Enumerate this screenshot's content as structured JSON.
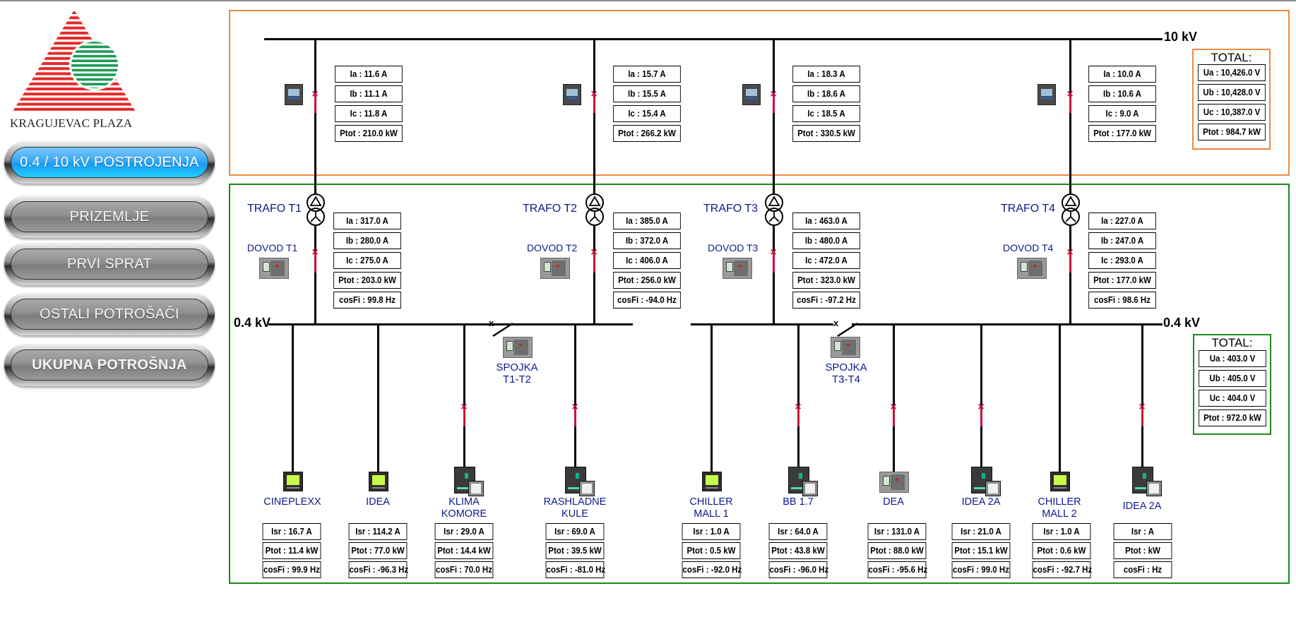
{
  "logo": {
    "text": "KRAGUJEVAC PLAZA"
  },
  "nav": [
    {
      "label": "0.4 / 10 kV POSTROJENJA",
      "active": true
    },
    {
      "label": "PRIZEMLJE",
      "active": false
    },
    {
      "label": "PRVI SPRAT",
      "active": false
    },
    {
      "label": "OSTALI POTROŠAČI",
      "active": false
    },
    {
      "label": "UKUPNA POTROŠNJA",
      "active": false
    }
  ],
  "mv": {
    "bus_label": "10 kV",
    "feeders": [
      {
        "ia": "Ia : 11.6 A",
        "ib": "Ib : 11.1 A",
        "ic": "Ic : 11.8 A",
        "ptot": "Ptot : 210.0 kW"
      },
      {
        "ia": "Ia : 15.7 A",
        "ib": "Ib : 15.5 A",
        "ic": "Ic : 15.4 A",
        "ptot": "Ptot : 266.2 kW"
      },
      {
        "ia": "Ia : 18.3 A",
        "ib": "Ib : 18.6 A",
        "ic": "Ic : 18.5 A",
        "ptot": "Ptot : 330.5 kW"
      },
      {
        "ia": "Ia : 10.0 A",
        "ib": "Ib : 10.6 A",
        "ic": "Ic : 9.0 A",
        "ptot": "Ptot : 177.0 kW"
      }
    ],
    "total": {
      "title": "TOTAL:",
      "ua": "Ua : 10,426.0 V",
      "ub": "Ub : 10,428.0 V",
      "uc": "Uc : 10,387.0 V",
      "ptot": "Ptot : 984.7 kW"
    }
  },
  "lv": {
    "bus_label": "0.4 kV",
    "transformers": [
      {
        "trafo": "TRAFO T1",
        "dovod": "DOVOD T1",
        "ia": "Ia : 317.0 A",
        "ib": "Ib : 280.0 A",
        "ic": "Ic : 275.0 A",
        "ptot": "Ptot : 203.0 kW",
        "cosfi": "cosFi : 99.8 Hz"
      },
      {
        "trafo": "TRAFO T2",
        "dovod": "DOVOD T2",
        "ia": "Ia : 385.0 A",
        "ib": "Ib : 372.0 A",
        "ic": "Ic : 406.0 A",
        "ptot": "Ptot : 256.0 kW",
        "cosfi": "cosFi : -94.0 Hz"
      },
      {
        "trafo": "TRAFO T3",
        "dovod": "DOVOD T3",
        "ia": "Ia : 463.0 A",
        "ib": "Ib : 480.0 A",
        "ic": "Ic : 472.0 A",
        "ptot": "Ptot : 323.0 kW",
        "cosfi": "cosFi : -97.2 Hz"
      },
      {
        "trafo": "TRAFO T4",
        "dovod": "DOVOD T4",
        "ia": "Ia : 227.0 A",
        "ib": "Ib : 247.0 A",
        "ic": "Ic : 293.0 A",
        "ptot": "Ptot : 177.0 kW",
        "cosfi": "cosFi : 98.6 Hz"
      }
    ],
    "couplers": [
      {
        "line1": "SPOJKA",
        "line2": "T1-T2"
      },
      {
        "line1": "SPOJKA",
        "line2": "T3-T4"
      }
    ],
    "loads": [
      {
        "name1": "CINEPLEXX",
        "name2": "",
        "isr": "Isr : 16.7 A",
        "ptot": "Ptot : 11.4 kW",
        "cosfi": "cosFi : 99.9 Hz"
      },
      {
        "name1": "IDEA",
        "name2": "",
        "isr": "Isr : 114.2 A",
        "ptot": "Ptot : 77.0 kW",
        "cosfi": "cosFi : -96.3 Hz"
      },
      {
        "name1": "KLIMA",
        "name2": "KOMORE",
        "isr": "Isr : 29.0 A",
        "ptot": "Ptot : 14.4 kW",
        "cosfi": "cosFi : 70.0 Hz"
      },
      {
        "name1": "RASHLADNE",
        "name2": "KULE",
        "isr": "Isr : 69.0 A",
        "ptot": "Ptot : 39.5 kW",
        "cosfi": "cosFi : -81.0 Hz"
      },
      {
        "name1": "CHILLER",
        "name2": "MALL 1",
        "isr": "Isr : 1.0 A",
        "ptot": "Ptot : 0.5 kW",
        "cosfi": "cosFi : -92.0 Hz"
      },
      {
        "name1": "BB 1.7",
        "name2": "",
        "isr": "Isr : 64.0 A",
        "ptot": "Ptot : 43.8 kW",
        "cosfi": "cosFi : -96.0 Hz"
      },
      {
        "name1": "DEA",
        "name2": "",
        "isr": "Isr : 131.0 A",
        "ptot": "Ptot : 88.0 kW",
        "cosfi": "cosFi : -95.6 Hz"
      },
      {
        "name1": "IDEA 2A",
        "name2": "",
        "isr": "Isr : 21.0 A",
        "ptot": "Ptot : 15.1 kW",
        "cosfi": "cosFi : 99.0 Hz"
      },
      {
        "name1": "CHILLER",
        "name2": "MALL 2",
        "isr": "Isr : 1.0 A",
        "ptot": "Ptot : 0.6 kW",
        "cosfi": "cosFi : -92.7 Hz"
      },
      {
        "name1": "IDEA 2A",
        "name2": "",
        "isr": "Isr :  A",
        "ptot": "Ptot :  kW",
        "cosfi": "cosFi :  Hz"
      }
    ],
    "total": {
      "title": "TOTAL:",
      "ua": "Ua : 403.0 V",
      "ub": "Ub : 405.0 V",
      "uc": "Uc : 404.0 V",
      "ptot": "Ptot : 972.0 kW"
    }
  },
  "colors": {
    "mv_frame": "#f0883e",
    "lv_frame": "#1a8a1a",
    "breaker_closed": "#c8103c",
    "label_blue": "#0d1a8c",
    "active_button": "#1a9bf0"
  }
}
